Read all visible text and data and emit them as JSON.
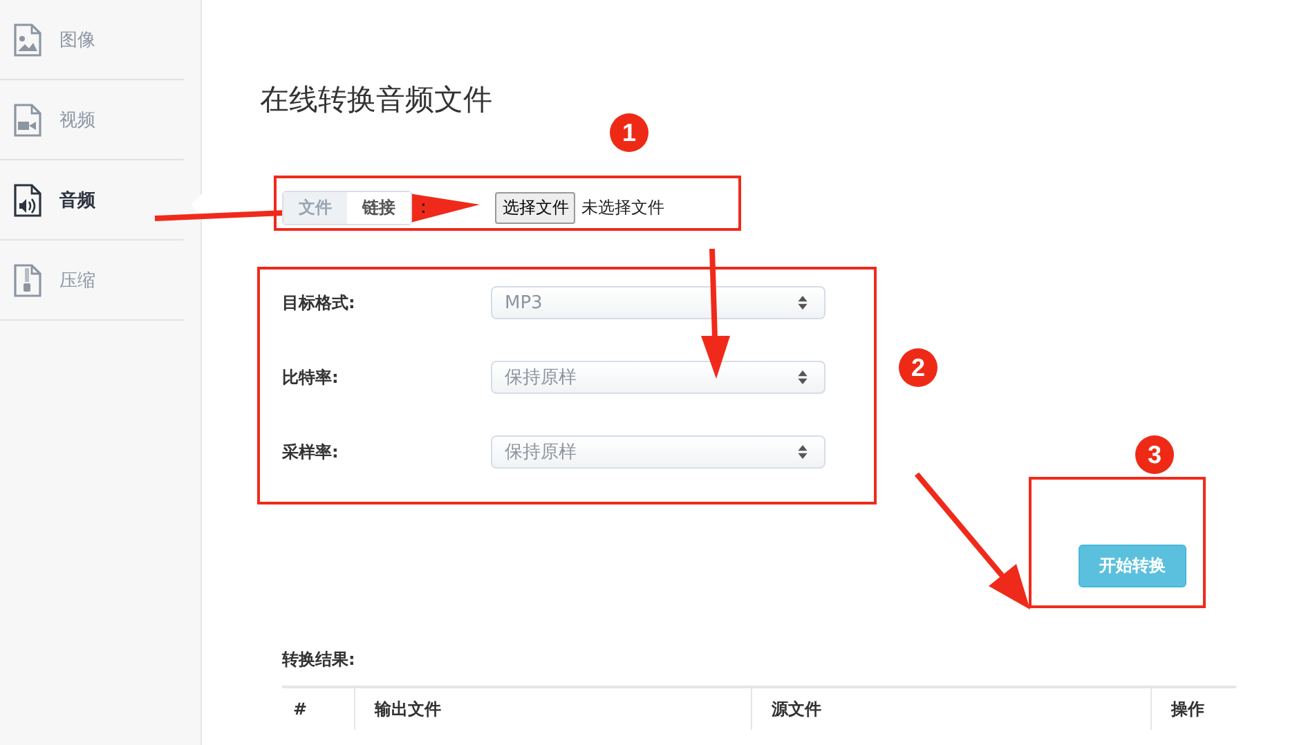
{
  "sidebar": {
    "items": [
      {
        "label": "图像",
        "selected": false
      },
      {
        "label": "视频",
        "selected": false
      },
      {
        "label": "音频",
        "selected": true
      },
      {
        "label": "压缩",
        "selected": false
      }
    ]
  },
  "title": "在线转换音频文件",
  "source_tabs": [
    {
      "label": "文件",
      "selected": true
    },
    {
      "label": "链接",
      "selected": false
    }
  ],
  "source_colon": ":",
  "file_button": "选择文件",
  "file_status": "未选择文件",
  "options": [
    {
      "label": "目标格式:",
      "value": "MP3"
    },
    {
      "label": "比特率:",
      "value": "保持原样"
    },
    {
      "label": "采样率:",
      "value": "保持原样"
    }
  ],
  "start_button": "开始转换",
  "results": {
    "label": "转换结果:",
    "columns": [
      "#",
      "输出文件",
      "源文件",
      "操作"
    ]
  },
  "annotations": [
    {
      "label": "1"
    },
    {
      "label": "2"
    },
    {
      "label": "3"
    }
  ]
}
